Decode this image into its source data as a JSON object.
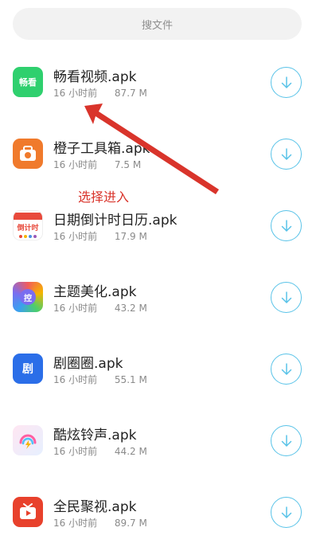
{
  "search": {
    "placeholder": "搜文件"
  },
  "files": [
    {
      "name": "畅看视频.apk",
      "time": "16 小时前",
      "size": "87.7 M",
      "icon": "changkan-app-icon",
      "icon_text": "畅看",
      "icon_color": "#2fd06e"
    },
    {
      "name": "橙子工具箱.apk",
      "time": "16 小时前",
      "size": "7.5 M",
      "icon": "chengzi-toolbox-app-icon",
      "icon_text": "",
      "icon_color": "#f07a2c"
    },
    {
      "name": "日期倒计时日历.apk",
      "time": "16 小时前",
      "size": "17.9 M",
      "icon": "countdown-calendar-app-icon",
      "icon_text": "倒计时",
      "icon_color": "#ffffff"
    },
    {
      "name": "主题美化.apk",
      "time": "16 小时前",
      "size": "43.2 M",
      "icon": "theme-beautify-app-icon",
      "icon_text": "控",
      "icon_color": "#7a6df0"
    },
    {
      "name": "剧圈圈.apk",
      "time": "16 小时前",
      "size": "55.1 M",
      "icon": "juquanquan-app-icon",
      "icon_text": "剧",
      "icon_color": "#2b6ee8"
    },
    {
      "name": "酷炫铃声.apk",
      "time": "16 小时前",
      "size": "44.2 M",
      "icon": "cool-ringtone-app-icon",
      "icon_text": "",
      "icon_color": "#ffffff"
    },
    {
      "name": "全民聚视.apk",
      "time": "16 小时前",
      "size": "89.7 M",
      "icon": "quanmin-jushi-app-icon",
      "icon_text": "",
      "icon_color": "#e8412c"
    }
  ],
  "annotation": {
    "text": "选择进入",
    "color": "#d9342b"
  },
  "accent_color": "#59c3e8"
}
